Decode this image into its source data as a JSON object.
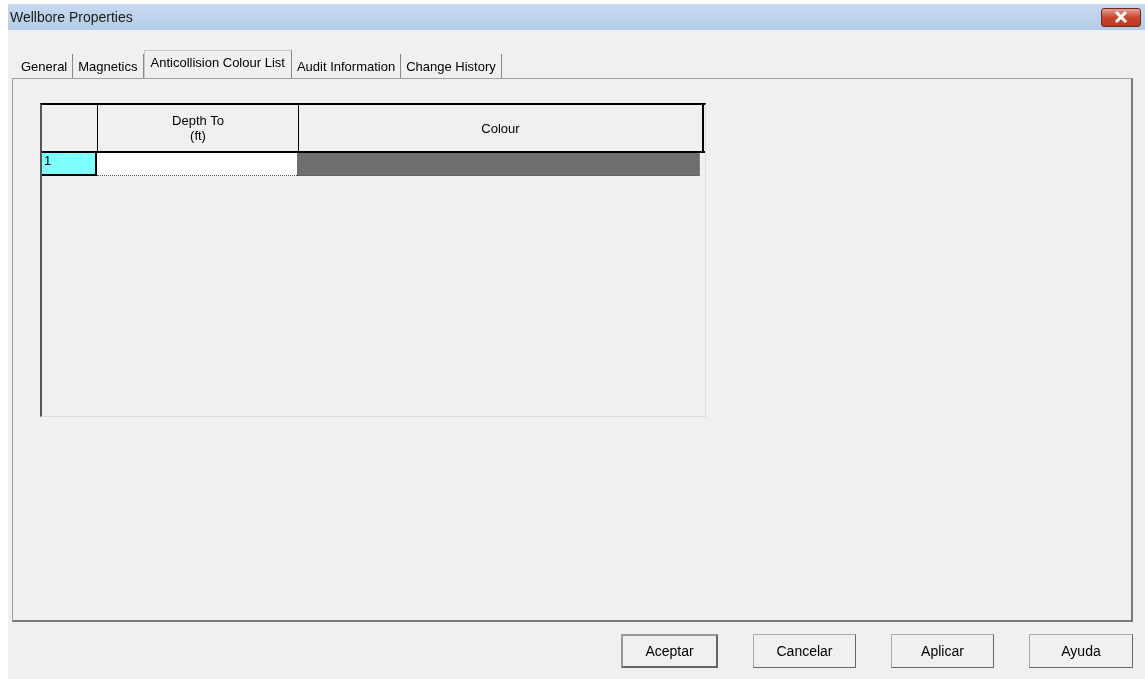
{
  "window": {
    "title": "Wellbore Properties"
  },
  "tabs": [
    {
      "label": "General",
      "selected": false
    },
    {
      "label": "Magnetics",
      "selected": false
    },
    {
      "label": "Anticollision Colour List",
      "selected": true
    },
    {
      "label": "Audit Information",
      "selected": false
    },
    {
      "label": "Change History",
      "selected": false
    }
  ],
  "table": {
    "columns": [
      {
        "label": "Depth To",
        "unit": "(ft)"
      },
      {
        "label": "Colour"
      }
    ],
    "rows": [
      {
        "number": "1",
        "selected": true,
        "color": "#6e6e6e"
      }
    ]
  },
  "buttons": [
    {
      "label": "Aceptar",
      "default": true
    },
    {
      "label": "Cancelar",
      "default": false
    },
    {
      "label": "Aplicar",
      "default": false
    },
    {
      "label": "Ayuda",
      "default": false
    }
  ]
}
